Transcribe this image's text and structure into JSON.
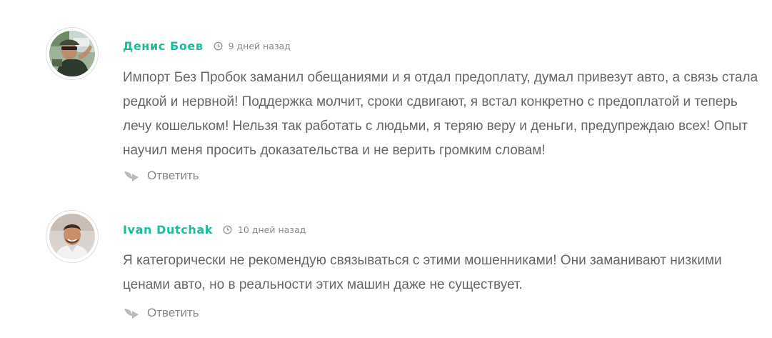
{
  "colors": {
    "author": "#1abc9c",
    "body_text": "#666666",
    "muted": "#888888",
    "reply_icon": "#bbbbbb"
  },
  "comments": [
    {
      "author": "Денис Боев",
      "time_icon": "clock-icon",
      "time": "9 дней назад",
      "lines": [
        "Импорт Без Пробок заманил обещаниями и я отдал предоплату, думал привезут авто, а связь стала",
        "редкой и нервной! Поддержка молчит, сроки сдвигают, я встал конкретно с предоплатой и теперь",
        "лечу кошельком! Нельзя так работать с людьми, я теряю веру и деньги, предупреждаю всех! Опыт",
        "научил меня просить доказательства и не верить громким словам!"
      ],
      "reply_icon": "reply-arrow-icon",
      "reply_label": "Ответить"
    },
    {
      "author": "Ivan Dutchak",
      "time_icon": "clock-icon",
      "time": "10 дней назад",
      "lines": [
        "Я категорически не рекомендую связываться с этими мошенниками! Они заманивают низкими",
        "ценами авто, но в реальности этих машин даже не существует."
      ],
      "reply_icon": "reply-arrow-icon",
      "reply_label": "Ответить"
    }
  ]
}
